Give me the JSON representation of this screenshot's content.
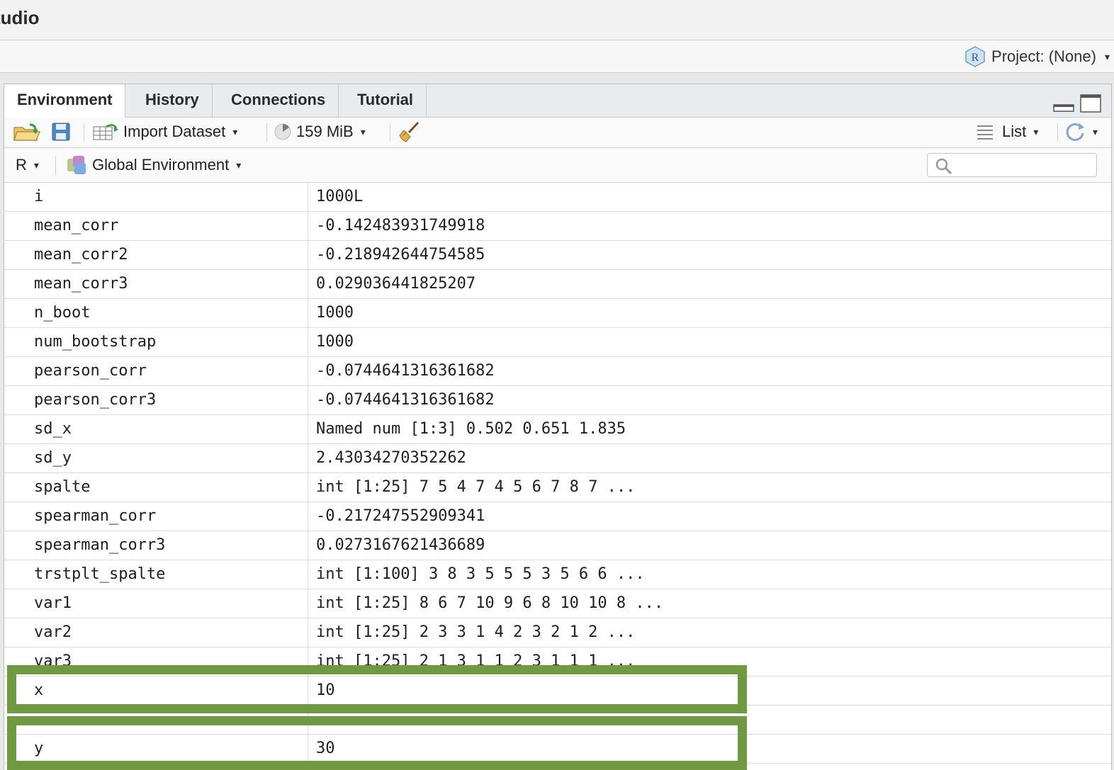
{
  "window": {
    "title": "tudio"
  },
  "project": {
    "label": "Project: (None)"
  },
  "tabs": [
    {
      "label": "Environment",
      "active": true
    },
    {
      "label": "History",
      "active": false
    },
    {
      "label": "Connections",
      "active": false
    },
    {
      "label": "Tutorial",
      "active": false
    }
  ],
  "toolbar": {
    "import_label": "Import Dataset",
    "memory_label": "159 MiB",
    "view_label": "List"
  },
  "envbar": {
    "language": "R",
    "environment": "Global Environment",
    "search_placeholder": ""
  },
  "variables": [
    {
      "name": "i",
      "value": "1000L"
    },
    {
      "name": "mean_corr",
      "value": "-0.142483931749918"
    },
    {
      "name": "mean_corr2",
      "value": "-0.218942644754585"
    },
    {
      "name": "mean_corr3",
      "value": "0.029036441825207"
    },
    {
      "name": "n_boot",
      "value": "1000"
    },
    {
      "name": "num_bootstrap",
      "value": "1000"
    },
    {
      "name": "pearson_corr",
      "value": "-0.0744641316361682"
    },
    {
      "name": "pearson_corr3",
      "value": "-0.0744641316361682"
    },
    {
      "name": "sd_x",
      "value": "Named num [1:3] 0.502 0.651 1.835"
    },
    {
      "name": "sd_y",
      "value": "2.43034270352262"
    },
    {
      "name": "spalte",
      "value": "int [1:25] 7 5 4 7 4 5 6 7 8 7 ..."
    },
    {
      "name": "spearman_corr",
      "value": "-0.217247552909341"
    },
    {
      "name": "spearman_corr3",
      "value": "0.0273167621436689"
    },
    {
      "name": "trstplt_spalte",
      "value": "int [1:100] 3 8 3 5 5 5 3 5 6 6 ..."
    },
    {
      "name": "var1",
      "value": "int [1:25] 8 6 7 10 9 6 8 10 10 8 ..."
    },
    {
      "name": "var2",
      "value": "int [1:25] 2 3 3 1 4 2 3 2 1 2 ..."
    },
    {
      "name": "var3",
      "value": "int [1:25] 2 1 3 1 1 2 3 1 1 1 ..."
    },
    {
      "name": "x",
      "value": "10"
    },
    {
      "name": "",
      "value": ""
    },
    {
      "name": "y",
      "value": "30"
    }
  ],
  "colors": {
    "highlight": "#6f9a41"
  }
}
